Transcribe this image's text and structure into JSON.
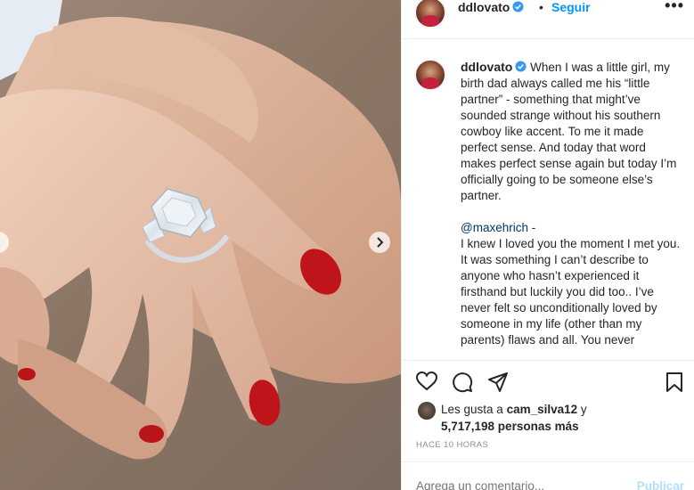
{
  "post": {
    "username": "ddlovato",
    "follow_label": "Seguir",
    "follow_separator": "•",
    "more_label": "•••"
  },
  "caption": {
    "username": "ddlovato",
    "paragraph1": "When I was a little girl, my birth dad always called me his “little partner” - something that might’ve sounded strange without his southern cowboy like accent. To me it made perfect sense. And today that word makes perfect sense again but today I’m officially going to be someone else’s partner.",
    "mention": "@maxehrich",
    "mention_suffix": " -",
    "line1": "I knew I loved you the moment I met you.",
    "line2": "It was something I can’t describe to anyone who hasn’t experienced it firsthand but luckily you did too.. I’ve never felt so unconditionally loved by someone in my life (other than my parents) flaws and all. You never"
  },
  "likes": {
    "prefix": "Les gusta a ",
    "user": "cam_silva12",
    "joiner": " y",
    "count": "5,717,198 personas más"
  },
  "timestamp": "HACE 10 HORAS",
  "comment": {
    "placeholder": "Agrega un comentario...",
    "publish_label": "Publicar"
  },
  "icons": [
    "heart-icon",
    "comment-icon",
    "share-icon",
    "bookmark-icon",
    "verified-icon",
    "chevron-right-icon"
  ],
  "colors": {
    "accent": "#0095f6",
    "mention": "#00376b",
    "publish_disabled": "#b2dffc",
    "nail": "#c0141b"
  }
}
